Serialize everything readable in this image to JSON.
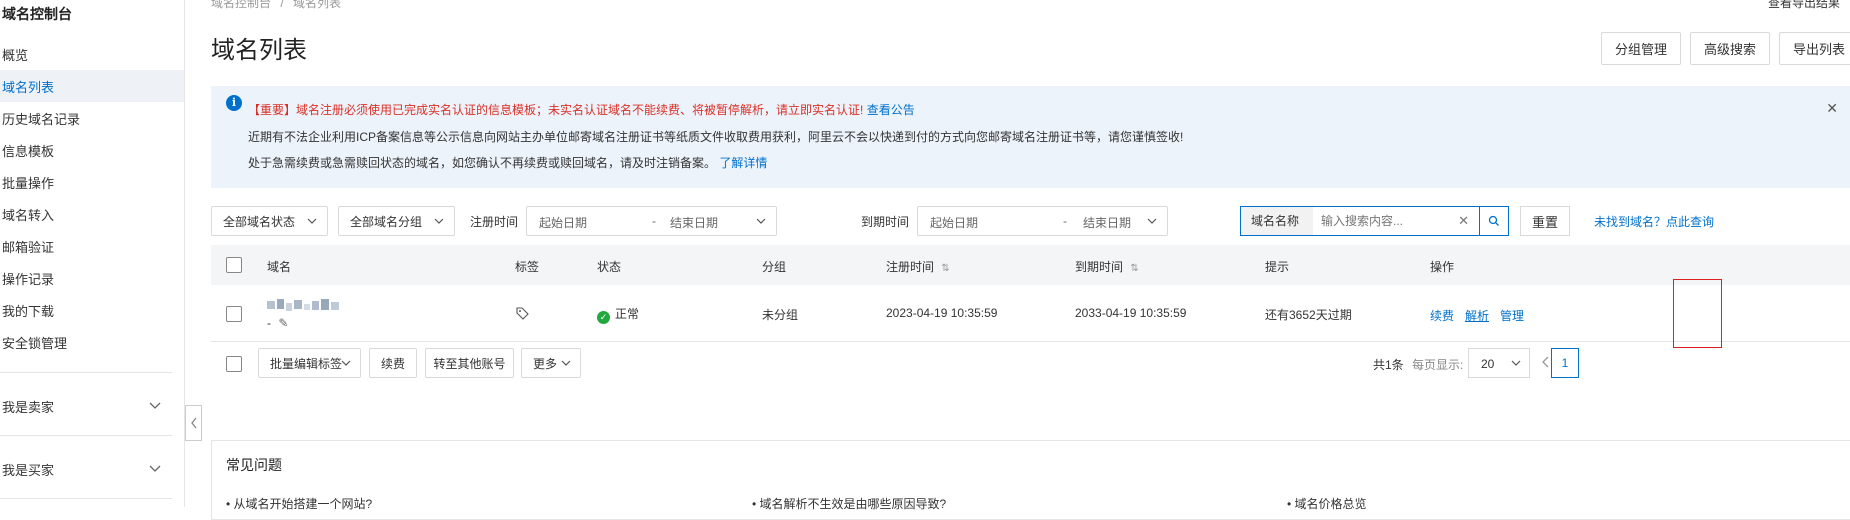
{
  "sidebar": {
    "title": "域名控制台",
    "items": [
      {
        "label": "概览"
      },
      {
        "label": "域名列表",
        "active": true
      },
      {
        "label": "历史域名记录"
      },
      {
        "label": "信息模板"
      },
      {
        "label": "批量操作"
      },
      {
        "label": "域名转入"
      },
      {
        "label": "邮箱验证"
      },
      {
        "label": "操作记录"
      },
      {
        "label": "我的下载"
      },
      {
        "label": "安全锁管理"
      }
    ],
    "groups": [
      {
        "label": "我是卖家"
      },
      {
        "label": "我是买家"
      }
    ]
  },
  "header": {
    "breadcrumb_root": "域名控制台",
    "breadcrumb_sep": "/",
    "breadcrumb_current": "域名列表",
    "top_link": "查看导出结果",
    "title": "域名列表",
    "buttons": {
      "group_manage": "分组管理",
      "advanced_search": "高级搜索",
      "export_list": "导出列表"
    }
  },
  "notice": {
    "line1_red": "【重要】域名注册必须使用已完成实名认证的信息模板；未实名认证域名不能续费、将被暂停解析，请立即实名认证!",
    "line1_link": "查看公告",
    "line2": "近期有不法企业利用ICP备案信息等公示信息向网站主办单位邮寄域名注册证书等纸质文件收取费用获利，阿里云不会以快递到付的方式向您邮寄域名注册证书等，请您谨慎签收!",
    "line3": "处于急需续费或急需赎回状态的域名，如您确认不再续费或赎回域名，请及时注销备案。",
    "line3_link": "了解详情"
  },
  "filters": {
    "status": "全部域名状态",
    "group": "全部域名分组",
    "reg_label": "注册时间",
    "exp_label": "到期时间",
    "start_date": "起始日期",
    "date_sep": "-",
    "end_date": "结束日期",
    "search_field": "域名名称",
    "search_placeholder": "输入搜索内容...",
    "reset": "重置",
    "not_found_link": "未找到域名？点此查询"
  },
  "table": {
    "columns": {
      "domain": "域名",
      "tag": "标签",
      "status": "状态",
      "group": "分组",
      "reg_time": "注册时间",
      "exp_time": "到期时间",
      "tip": "提示",
      "ops": "操作"
    },
    "rows": [
      {
        "domain_sub": "-",
        "status": "正常",
        "group": "未分组",
        "reg_time": "2023-04-19 10:35:59",
        "exp_time": "2033-04-19 10:35:59",
        "tip": "还有3652天过期",
        "ops": {
          "renew": "续费",
          "resolve": "解析",
          "manage": "管理"
        }
      }
    ]
  },
  "bottom": {
    "batch_tag": "批量编辑标签",
    "renew": "续费",
    "transfer": "转至其他账号",
    "more": "更多",
    "total": "共1条",
    "per_page_label": "每页显示:",
    "per_page": "20",
    "current_page": "1"
  },
  "faq": {
    "title": "常见问题",
    "items": [
      "• 从域名开始搭建一个网站?",
      "• 域名解析不生效是由哪些原因导致?",
      "• 域名价格总览"
    ]
  },
  "colors": {
    "accent": "#0070cc",
    "danger": "#d93026",
    "success": "#23a73f"
  }
}
